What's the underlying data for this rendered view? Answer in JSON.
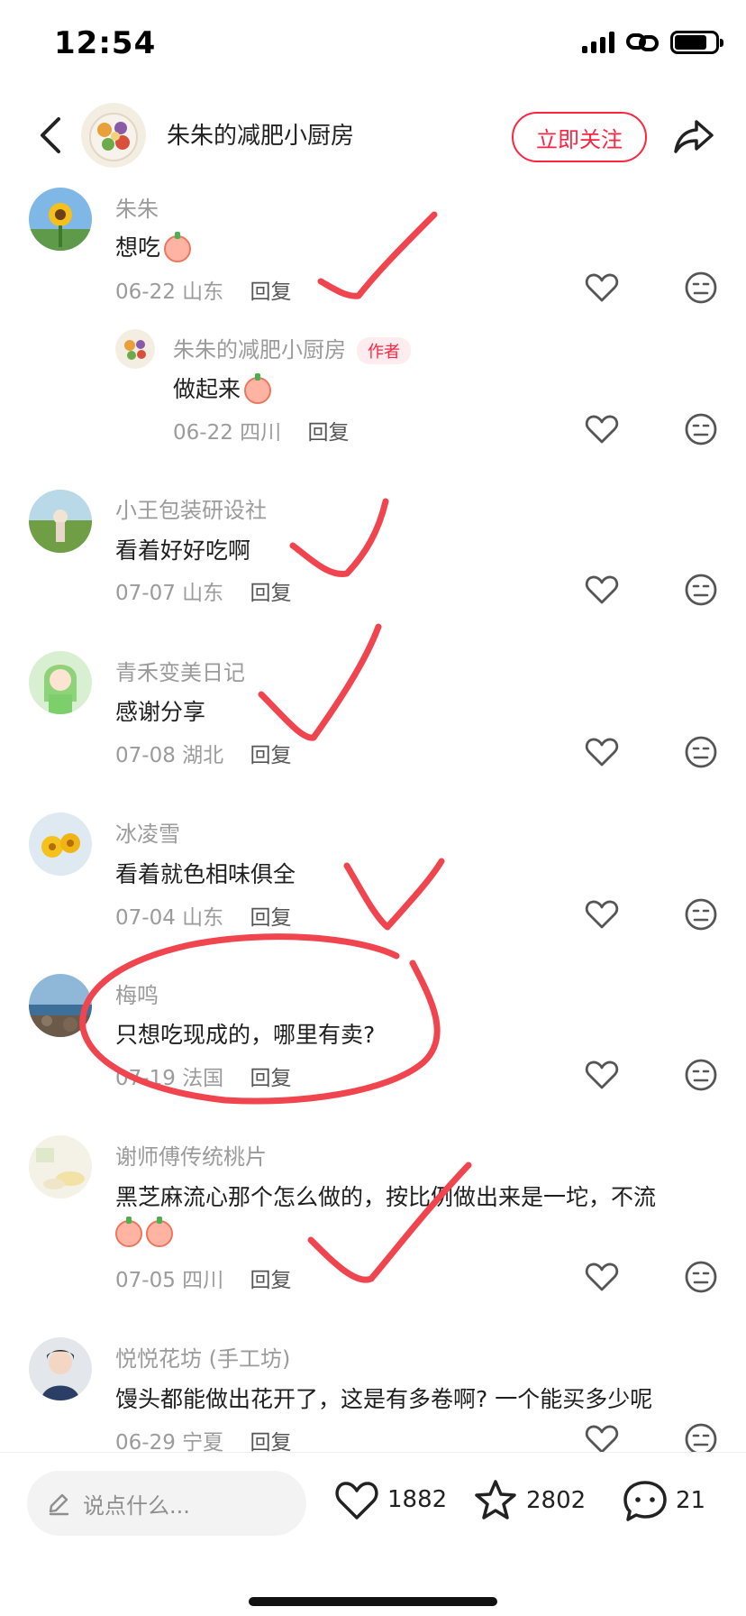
{
  "status_bar": {
    "time": "12:54"
  },
  "header": {
    "author_name": "朱朱的减肥小厨房",
    "follow_label": "立即关注"
  },
  "comments": [
    {
      "user": "朱朱",
      "text": "想吃",
      "date": "06-22",
      "location": "山东",
      "reply": "回复"
    },
    {
      "user": "朱朱的减肥小厨房",
      "tag": "作者",
      "text": "做起来",
      "date": "06-22",
      "location": "四川",
      "reply": "回复"
    },
    {
      "user": "小王包装研设社",
      "text": "看着好好吃啊",
      "date": "07-07",
      "location": "山东",
      "reply": "回复"
    },
    {
      "user": "青禾变美日记",
      "text": "感谢分享",
      "date": "07-08",
      "location": "湖北",
      "reply": "回复"
    },
    {
      "user": "冰凌雪",
      "text": "看着就色相味俱全",
      "date": "07-04",
      "location": "山东",
      "reply": "回复"
    },
    {
      "user": "梅鸣",
      "text": "只想吃现成的，哪里有卖?",
      "date": "07-19",
      "location": "法国",
      "reply": "回复"
    },
    {
      "user": "谢师傅传统桃片",
      "text": "黑芝麻流心那个怎么做的，按比例做出来是一坨，不流",
      "date": "07-05",
      "location": "四川",
      "reply": "回复"
    },
    {
      "user": "悦悦花坊 (手工坊)",
      "text": "馒头都能做出花开了，这是有多卷啊? 一个能买多少呢",
      "date": "06-29",
      "location": "宁夏",
      "reply": "回复"
    }
  ],
  "bottom_bar": {
    "input_placeholder": "说点什么...",
    "likes": "1882",
    "stars": "2802",
    "comments": "21"
  },
  "icons": [
    "back-icon",
    "share-icon",
    "heart-icon",
    "dislike-face-icon",
    "pencil-icon",
    "star-icon",
    "chat-bubble-icon"
  ],
  "colors": {
    "accent": "#ff2442",
    "annotation": "#f0454f",
    "muted_text": "#9b9b9b"
  }
}
